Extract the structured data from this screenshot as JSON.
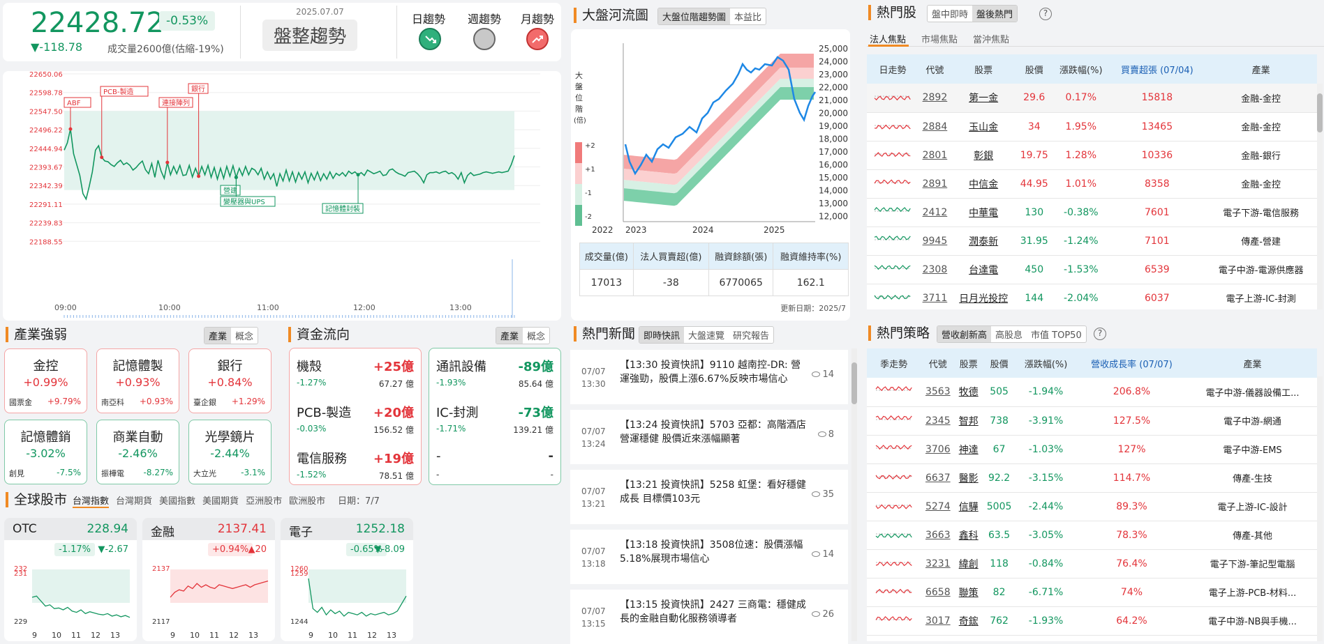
{
  "header": {
    "index": "22428.72",
    "pct": "-0.53%",
    "change": "▼-118.78",
    "volume": "成交量2600億(估縮-19%)",
    "date": "2025.07.07",
    "trend": "盤整趨勢",
    "day": "日趨勢",
    "week": "週趨勢",
    "month": "月趨勢"
  },
  "intraday": {
    "ylabels": [
      "22650.06",
      "22598.78",
      "22547.50",
      "22496.22",
      "22444.94",
      "22393.67",
      "22342.39",
      "22291.11",
      "22239.83",
      "22188.55"
    ],
    "xlabels": [
      "09:00",
      "10:00",
      "11:00",
      "12:00",
      "13:00"
    ],
    "events": [
      {
        "label": "ABF"
      },
      {
        "label": "PCB-製造"
      },
      {
        "label": "連接陣列"
      },
      {
        "label": "銀行"
      },
      {
        "label": "營建"
      },
      {
        "label": "變壓器與UPS"
      },
      {
        "label": "記憶體封裝"
      }
    ],
    "series": [
      22440,
      22460,
      22498,
      22430,
      22400,
      22370,
      22320,
      22305,
      22340,
      22380,
      22440,
      22452,
      22420,
      22410,
      22408,
      22400,
      22395,
      22405,
      22412,
      22400,
      22405,
      22398,
      22385,
      22392,
      22402,
      22410,
      22386,
      22375,
      22403,
      22365,
      22412,
      22382,
      22362,
      22406,
      22372,
      22395,
      22375,
      22398,
      22370,
      22372,
      22398,
      22366,
      22390,
      22368,
      22395,
      22372,
      22398,
      22365,
      22392,
      22360,
      22390,
      22362,
      22395,
      22368,
      22397,
      22365,
      22390,
      22370,
      22395,
      22372,
      22390,
      22385,
      22372,
      22390,
      22360,
      22380,
      22360,
      22375,
      22340,
      22375,
      22355,
      22385,
      22355,
      22380,
      22352,
      22378,
      22360,
      22380,
      22350,
      22376,
      22358,
      22380,
      22356,
      22375,
      22360,
      22380,
      22362,
      22376,
      22370,
      22378,
      22368,
      22382,
      22375,
      22380,
      22372,
      22378,
      22370,
      22385,
      22380,
      22375,
      22378,
      22382,
      22370,
      22372,
      22385,
      22388,
      22380,
      22375,
      22372,
      22368,
      22378,
      22380,
      22382,
      22375,
      22365,
      22350,
      22372,
      22378,
      22378,
      22380,
      22376,
      22380,
      22382,
      22375,
      22378,
      22372,
      22360,
      22378,
      22350,
      22370,
      22378,
      22370,
      22372,
      22374,
      22378,
      22380,
      22378,
      22376,
      22378,
      22380,
      22378,
      22380,
      22382,
      22400,
      22425
    ]
  },
  "sections": {
    "industry": "產業強弱",
    "flow": "資金流向",
    "global": "全球股市",
    "river": "大盤河流圖",
    "hot": "熱門股",
    "news": "熱門新聞",
    "strategy": "熱門策略"
  },
  "toggles": {
    "ind": [
      "產業",
      "概念"
    ],
    "river": [
      "大盤位階趨勢圖",
      "本益比"
    ],
    "hot": [
      "盤中即時",
      "盤後熱門"
    ],
    "news": [
      "即時快訊",
      "大盤速覽",
      "研究報告"
    ],
    "strat": [
      "營收創新高",
      "高股息",
      "市值 TOP50"
    ],
    "hot_tabs": [
      "法人焦點",
      "市場焦點",
      "當沖焦點"
    ],
    "global_tabs": [
      "台灣指數",
      "台灣期貨",
      "美國指數",
      "美國期貨",
      "亞洲股市",
      "歐洲股市"
    ],
    "global_date": "日期：7/7"
  },
  "industry": [
    {
      "name": "金控",
      "pct": "+0.99%",
      "stock": "國票金",
      "spct": "+9.79%",
      "color": "red"
    },
    {
      "name": "記憶體製",
      "pct": "+0.93%",
      "stock": "南亞科",
      "spct": "+0.93%",
      "color": "red"
    },
    {
      "name": "銀行",
      "pct": "+0.84%",
      "stock": "臺企銀",
      "spct": "+1.29%",
      "color": "red"
    },
    {
      "name": "記憶體銷",
      "pct": "-3.02%",
      "stock": "創見",
      "spct": "-7.5%",
      "color": "grn"
    },
    {
      "name": "商業自動",
      "pct": "-2.46%",
      "stock": "振樺電",
      "spct": "-8.27%",
      "color": "grn"
    },
    {
      "name": "光學鏡片",
      "pct": "-2.44%",
      "stock": "大立光",
      "spct": "-3.1%",
      "color": "grn"
    }
  ],
  "flow_in": [
    {
      "name": "機殼",
      "val": "+25億",
      "pct": "-1.27%",
      "amt": "67.27 億"
    },
    {
      "name": "PCB-製造",
      "val": "+20億",
      "pct": "-0.03%",
      "amt": "156.52 億"
    },
    {
      "name": "電信服務",
      "val": "+19億",
      "pct": "-1.52%",
      "amt": "78.51 億"
    }
  ],
  "flow_out": [
    {
      "name": "通訊設備",
      "val": "-89億",
      "pct": "-1.93%",
      "amt": "85.64 億"
    },
    {
      "name": "IC-封測",
      "val": "-73億",
      "pct": "-1.71%",
      "amt": "139.21 億"
    },
    {
      "name": "-",
      "val": "-",
      "pct": "-",
      "amt": "-"
    }
  ],
  "global": [
    {
      "name": "OTC",
      "val": "228.94",
      "pct": "-1.17%",
      "chg": "▼-2.67",
      "color": "grn",
      "ylabels": [
        "232",
        "231",
        "229"
      ],
      "xlabels": [
        "9",
        "10",
        "11",
        "12",
        "13"
      ]
    },
    {
      "name": "金融",
      "val": "2137.41",
      "pct": "+0.94%",
      "chg": "▲20",
      "color": "red",
      "ylabels": [
        "2137",
        "2117"
      ],
      "xlabels": [
        "9",
        "10",
        "11",
        "12",
        "13"
      ]
    },
    {
      "name": "電子",
      "val": "1252.18",
      "pct": "-0.65%",
      "chg": "▼-8.09",
      "color": "grn",
      "ylabels": [
        "1260",
        "1259",
        "1244"
      ],
      "xlabels": [
        "9",
        "10",
        "11",
        "12",
        "13"
      ]
    }
  ],
  "river": {
    "ylabels": [
      "25,000",
      "24,000",
      "23,000",
      "22,000",
      "21,000",
      "20,000",
      "19,000",
      "18,000",
      "17,000",
      "16,000",
      "15,000",
      "14,000",
      "13,000",
      "12,000"
    ],
    "xlabels": [
      "2022",
      "2023",
      "2024",
      "2025"
    ],
    "legend_title": "大盤位階(倍)",
    "legend": [
      "+2",
      "+1",
      "-1",
      "-2"
    ],
    "table_head": [
      "成交量(億)",
      "法人買賣超(億)",
      "融資餘額(張)",
      "融資維持率(%)"
    ],
    "table_row": [
      "17013",
      "-38",
      "6770065",
      "162.1"
    ],
    "updated": "更新日期：2025/7"
  },
  "hot_stocks": {
    "head": [
      "日走勢",
      "代號",
      "股票",
      "股價",
      "漲跌幅(%)",
      "買賣超張 (07/04)",
      "產業"
    ],
    "rows": [
      [
        "2892",
        "第一金",
        "29.6",
        "0.17%",
        "15818",
        "金融-金控",
        "red"
      ],
      [
        "2884",
        "玉山金",
        "34",
        "1.95%",
        "13465",
        "金融-金控",
        "red"
      ],
      [
        "2801",
        "彰銀",
        "19.75",
        "1.28%",
        "10336",
        "金融-銀行",
        "red"
      ],
      [
        "2891",
        "中信金",
        "44.95",
        "1.01%",
        "8358",
        "金融-金控",
        "red"
      ],
      [
        "2412",
        "中華電",
        "130",
        "-0.38%",
        "7601",
        "電子下游-電信服務",
        "grn"
      ],
      [
        "9945",
        "潤泰新",
        "31.95",
        "-1.24%",
        "7101",
        "傳產-營建",
        "grn"
      ],
      [
        "2308",
        "台達電",
        "450",
        "-1.53%",
        "6539",
        "電子中游-電源供應器",
        "grn"
      ],
      [
        "3711",
        "日月光投控",
        "144",
        "-2.04%",
        "6037",
        "電子上游-IC-封測",
        "grn"
      ]
    ]
  },
  "strategy": {
    "head": [
      "季走勢",
      "代號",
      "股票",
      "股價",
      "漲跌幅(%)",
      "營收成長率 (07/07)",
      "產業"
    ],
    "rows": [
      [
        "3563",
        "牧德",
        "505",
        "-1.94%",
        "206.8%",
        "電子中游-儀器設備工...",
        "red"
      ],
      [
        "2345",
        "智邦",
        "738",
        "-3.91%",
        "127.5%",
        "電子中游-網通",
        "red"
      ],
      [
        "3706",
        "神達",
        "67",
        "-1.03%",
        "127%",
        "電子中游-EMS",
        "red"
      ],
      [
        "6637",
        "醫影",
        "92.2",
        "-3.15%",
        "114.7%",
        "傳產-生技",
        "red"
      ],
      [
        "5274",
        "信驊",
        "5005",
        "-2.44%",
        "89.3%",
        "電子上游-IC-設計",
        "red"
      ],
      [
        "3663",
        "鑫科",
        "63.5",
        "-3.05%",
        "78.3%",
        "傳產-其他",
        "grn"
      ],
      [
        "3231",
        "緯創",
        "118",
        "-0.84%",
        "76.4%",
        "電子下游-筆記型電腦",
        "red"
      ],
      [
        "6658",
        "聯策",
        "82",
        "-6.71%",
        "74%",
        "電子上游-PCB-材料...",
        "red"
      ],
      [
        "3017",
        "奇鋐",
        "762",
        "-1.93%",
        "64.2%",
        "電子中游-NB與手機...",
        "red"
      ]
    ]
  },
  "news": [
    {
      "date": "07/07",
      "time": "13:30",
      "title": "【13:30 投資快訊】9110 越南控-DR: 營運強勁，股價上漲6.67%反映市場信心",
      "views": "14"
    },
    {
      "date": "07/07",
      "time": "13:24",
      "title": "【13:24 投資快訊】5703 亞都：高階酒店營運穩健 股價近來漲幅顯著",
      "views": "8"
    },
    {
      "date": "07/07",
      "time": "13:21",
      "title": "【13:21 投資快訊】5258 虹堡：看好穩健成長 目標價103元",
      "views": "35"
    },
    {
      "date": "07/07",
      "time": "13:18",
      "title": "【13:18 投資快訊】3508位速：股價漲幅5.18%展現市場信心",
      "views": "14"
    },
    {
      "date": "07/07",
      "time": "13:15",
      "title": "【13:15 投資快訊】2427 三商電：穩健成長的金融自動化服務領導者",
      "views": "26"
    }
  ],
  "colors": {
    "red": "#e3343a",
    "green": "#12965f",
    "accent": "#f08a24",
    "blue": "#1e88e5"
  }
}
